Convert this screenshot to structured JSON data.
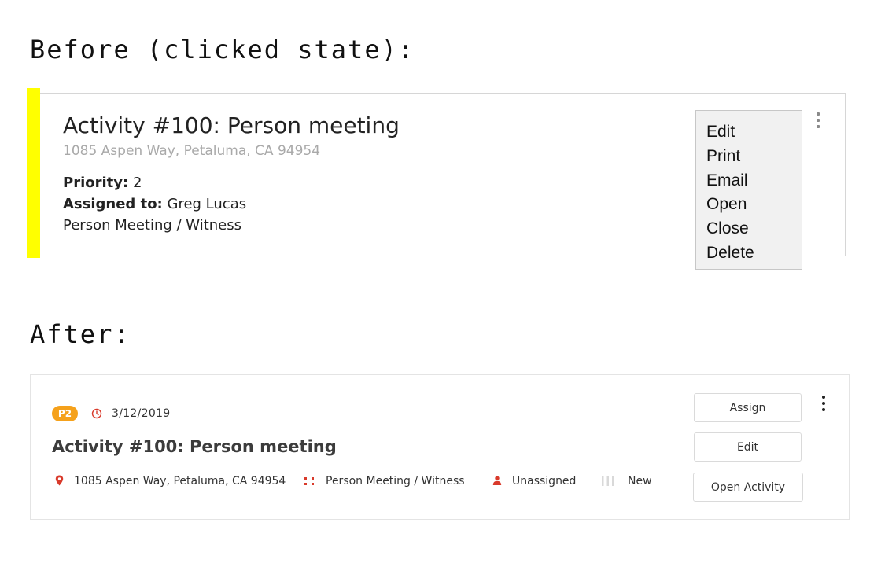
{
  "headings": {
    "before": "Before (clicked state):",
    "after": "After:"
  },
  "before": {
    "title": "Activity #100: Person meeting",
    "address": "1085 Aspen Way, Petaluma, CA 94954",
    "priority_label": "Priority:",
    "priority_value": "2",
    "assigned_label": "Assigned to:",
    "assigned_value": "Greg Lucas",
    "type": "Person Meeting / Witness",
    "accent_color": "#ffff00",
    "menu_icon": "kebab-menu-icon",
    "dropdown": [
      "Edit",
      "Print",
      "Email",
      "Open",
      "Close",
      "Delete"
    ]
  },
  "after": {
    "priority_badge": "P2",
    "badge_color": "#f5a11b",
    "date_icon": "clock-icon",
    "date": "3/12/2019",
    "title": "Activity #100: Person meeting",
    "address_icon": "map-pin-icon",
    "address": "1085 Aspen Way, Petaluma, CA 94954",
    "type_icon": "grid-dots-icon",
    "type": "Person Meeting / Witness",
    "assignee_icon": "person-icon",
    "assignee": "Unassigned",
    "status_icon": "status-bars-icon",
    "status": "New",
    "accent_red": "#d93a2b",
    "buttons": {
      "assign": "Assign",
      "edit": "Edit",
      "open": "Open Activity"
    },
    "menu_icon": "kebab-menu-icon"
  }
}
